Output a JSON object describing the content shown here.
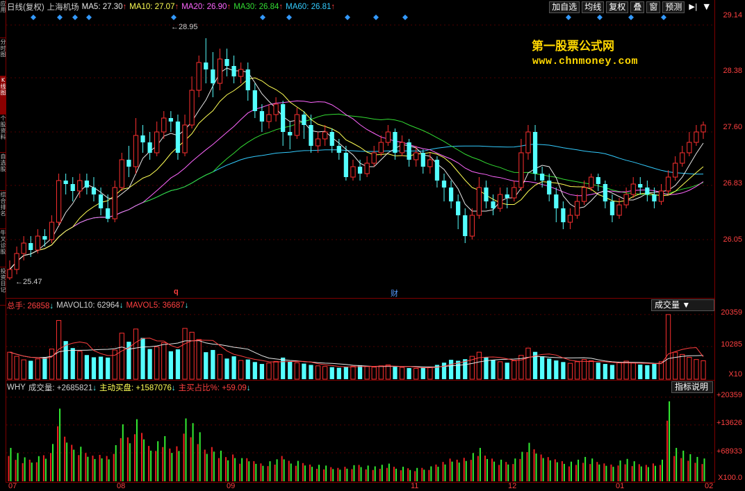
{
  "side_tabs": [
    {
      "label": "应用",
      "active": false
    },
    {
      "label": "分时图",
      "active": false
    },
    {
      "label": "K线图",
      "active": true
    },
    {
      "label": "个股资料",
      "active": false
    },
    {
      "label": "自选股",
      "active": false
    },
    {
      "label": "综合排名",
      "active": false
    },
    {
      "label": "牛叉诊股",
      "active": false
    },
    {
      "label": "投资日记",
      "active": false
    }
  ],
  "price_header": {
    "period": "日线(复权)",
    "stock_name": "上海机场",
    "ma5": "MA5: 27.30",
    "ma10": "MA10: 27.07",
    "ma20": "MA20: 26.90",
    "ma30": "MA30: 26.84",
    "ma60": "MA60: 26.81",
    "arrow_up": "↑"
  },
  "toolbar": {
    "add_watch": "加自选",
    "ma_line": "均线",
    "restore": "复权",
    "overlay": "叠",
    "window": "窗",
    "forecast": "预测",
    "nav_icon": "▶|",
    "menu_icon": "▼"
  },
  "watermark": {
    "title": "第一股票公式网",
    "url": "www.chnmoney.com"
  },
  "price_axis": [
    "29.14",
    "28.38",
    "27.60",
    "26.83",
    "26.05"
  ],
  "price_marks": {
    "high": "28.95",
    "low": "25.47",
    "q_marker": "q",
    "cai_marker": "财"
  },
  "volume_header": {
    "total": "总手: 26858",
    "mavol10": "MAVOL10: 62964",
    "mavol5": "MAVOL5: 36687",
    "arrow_down": "↓"
  },
  "volume_dropdown": "成交量 ▼",
  "volume_axis": [
    "20359",
    "10285",
    "X10"
  ],
  "why_header": {
    "name": "WHY",
    "volume": "成交量: +2685821",
    "active_buy": "主动买盘: +1587076",
    "ratio": "主买占比%: +59.09",
    "arrow_down": "↓"
  },
  "why_button": "指标说明",
  "why_axis": [
    "+20359",
    "+13626",
    "+68933",
    "X100.0"
  ],
  "time_axis": [
    "07",
    "08",
    "09",
    "11",
    "12",
    "01",
    "02"
  ],
  "colors": {
    "up": "#ff3030",
    "down": "#54ffff",
    "ma5": "#e8e8e8",
    "ma10": "#ffff55",
    "ma20": "#ff66ff",
    "ma30": "#33dd33",
    "ma60": "#33ccff",
    "frame": "#800000",
    "buy_bar": "#33ee33",
    "sell_bar": "#ee2020"
  },
  "chart_data": {
    "type": "candlestick",
    "price_range": [
      25.3,
      29.3
    ],
    "candles": [
      [
        25.5,
        25.62,
        25.47,
        25.75
      ],
      [
        25.62,
        25.85,
        25.55,
        25.95
      ],
      [
        25.85,
        26.0,
        25.75,
        26.1
      ],
      [
        26.0,
        25.9,
        25.8,
        26.1
      ],
      [
        25.9,
        26.1,
        25.85,
        26.2
      ],
      [
        26.1,
        26.05,
        25.95,
        26.2
      ],
      [
        26.05,
        26.3,
        26.0,
        26.4
      ],
      [
        26.3,
        26.9,
        26.25,
        27.0
      ],
      [
        26.9,
        26.85,
        26.7,
        27.0
      ],
      [
        26.85,
        26.75,
        26.6,
        26.95
      ],
      [
        26.75,
        26.9,
        26.65,
        27.0
      ],
      [
        26.9,
        26.8,
        26.7,
        27.0
      ],
      [
        26.8,
        26.7,
        26.6,
        26.95
      ],
      [
        26.7,
        26.5,
        26.4,
        26.8
      ],
      [
        26.5,
        26.35,
        26.3,
        26.7
      ],
      [
        26.35,
        26.8,
        26.3,
        26.9
      ],
      [
        26.8,
        27.2,
        26.75,
        27.3
      ],
      [
        27.2,
        27.1,
        26.95,
        27.4
      ],
      [
        27.1,
        27.55,
        27.0,
        27.8
      ],
      [
        27.55,
        27.45,
        27.3,
        27.7
      ],
      [
        27.45,
        27.3,
        27.2,
        27.6
      ],
      [
        27.3,
        27.6,
        27.25,
        27.75
      ],
      [
        27.6,
        27.8,
        27.5,
        27.9
      ],
      [
        27.8,
        27.75,
        27.6,
        27.9
      ],
      [
        27.75,
        27.3,
        27.2,
        27.85
      ],
      [
        27.3,
        27.7,
        27.25,
        27.85
      ],
      [
        27.7,
        28.2,
        27.65,
        28.4
      ],
      [
        28.2,
        28.6,
        28.1,
        28.7
      ],
      [
        28.6,
        28.5,
        28.3,
        28.95
      ],
      [
        28.5,
        28.3,
        28.1,
        28.75
      ],
      [
        28.3,
        28.65,
        28.2,
        28.8
      ],
      [
        28.65,
        28.55,
        28.4,
        28.8
      ],
      [
        28.55,
        28.4,
        28.3,
        28.7
      ],
      [
        28.4,
        28.5,
        28.3,
        28.6
      ],
      [
        28.5,
        28.2,
        28.05,
        28.6
      ],
      [
        28.2,
        27.9,
        27.8,
        28.3
      ],
      [
        27.9,
        27.75,
        27.6,
        28.0
      ],
      [
        27.75,
        27.85,
        27.65,
        28.0
      ],
      [
        27.85,
        28.0,
        27.75,
        28.1
      ],
      [
        28.0,
        27.6,
        27.4,
        28.05
      ],
      [
        27.6,
        27.55,
        27.35,
        27.75
      ],
      [
        27.55,
        27.85,
        27.5,
        27.95
      ],
      [
        27.85,
        27.7,
        27.5,
        27.9
      ],
      [
        27.7,
        27.4,
        27.3,
        27.85
      ],
      [
        27.4,
        27.5,
        27.3,
        27.6
      ],
      [
        27.5,
        27.6,
        27.4,
        27.7
      ],
      [
        27.6,
        27.4,
        27.3,
        27.65
      ],
      [
        27.4,
        27.3,
        27.2,
        27.5
      ],
      [
        27.3,
        26.95,
        26.9,
        27.4
      ],
      [
        26.95,
        27.1,
        26.9,
        27.2
      ],
      [
        27.1,
        27.0,
        26.9,
        27.2
      ],
      [
        27.0,
        27.15,
        26.95,
        27.25
      ],
      [
        27.15,
        27.3,
        27.1,
        27.4
      ],
      [
        27.3,
        27.45,
        27.25,
        27.55
      ],
      [
        27.45,
        27.6,
        27.4,
        27.7
      ],
      [
        27.6,
        27.3,
        27.2,
        27.65
      ],
      [
        27.3,
        27.45,
        27.25,
        27.55
      ],
      [
        27.45,
        27.2,
        27.1,
        27.5
      ],
      [
        27.2,
        27.3,
        27.1,
        27.4
      ],
      [
        27.3,
        27.1,
        27.0,
        27.35
      ],
      [
        27.1,
        27.2,
        27.0,
        27.3
      ],
      [
        27.2,
        26.9,
        26.8,
        27.25
      ],
      [
        26.9,
        26.8,
        26.6,
        27.0
      ],
      [
        26.8,
        26.6,
        26.5,
        26.9
      ],
      [
        26.6,
        26.4,
        26.2,
        26.7
      ],
      [
        26.4,
        26.1,
        26.0,
        26.5
      ],
      [
        26.1,
        26.4,
        26.05,
        26.5
      ],
      [
        26.4,
        26.8,
        26.35,
        26.95
      ],
      [
        26.8,
        26.6,
        26.5,
        26.9
      ],
      [
        26.6,
        26.5,
        26.4,
        26.7
      ],
      [
        26.5,
        26.7,
        26.45,
        26.8
      ],
      [
        26.7,
        26.65,
        26.5,
        26.8
      ],
      [
        26.65,
        26.8,
        26.6,
        26.9
      ],
      [
        26.8,
        27.3,
        26.75,
        27.5
      ],
      [
        27.3,
        27.6,
        27.2,
        27.7
      ],
      [
        27.6,
        27.0,
        26.9,
        27.7
      ],
      [
        27.0,
        26.9,
        26.8,
        27.1
      ],
      [
        26.9,
        26.7,
        26.6,
        27.0
      ],
      [
        26.7,
        26.5,
        26.3,
        26.8
      ],
      [
        26.5,
        26.3,
        26.2,
        26.6
      ],
      [
        26.3,
        26.4,
        26.2,
        26.5
      ],
      [
        26.4,
        26.6,
        26.35,
        26.7
      ],
      [
        26.6,
        26.8,
        26.55,
        26.9
      ],
      [
        26.8,
        26.95,
        26.75,
        27.0
      ],
      [
        26.95,
        26.85,
        26.75,
        27.0
      ],
      [
        26.85,
        26.6,
        26.5,
        26.9
      ],
      [
        26.6,
        26.4,
        26.3,
        26.7
      ],
      [
        26.4,
        26.55,
        26.35,
        26.65
      ],
      [
        26.55,
        26.7,
        26.5,
        26.8
      ],
      [
        26.7,
        26.85,
        26.65,
        26.95
      ],
      [
        26.85,
        26.8,
        26.7,
        26.95
      ],
      [
        26.8,
        26.7,
        26.6,
        26.9
      ],
      [
        26.7,
        26.6,
        26.5,
        26.8
      ],
      [
        26.6,
        26.75,
        26.55,
        26.85
      ],
      [
        26.75,
        26.95,
        26.7,
        27.05
      ],
      [
        26.95,
        27.15,
        26.9,
        27.25
      ],
      [
        27.15,
        27.3,
        27.1,
        27.4
      ],
      [
        27.3,
        27.45,
        27.25,
        27.6
      ],
      [
        27.45,
        27.6,
        27.4,
        27.7
      ],
      [
        27.6,
        27.7,
        27.5,
        27.75
      ]
    ],
    "volume_range": [
      0,
      21000
    ],
    "volumes": [
      8500,
      7200,
      6100,
      5800,
      6400,
      7000,
      9500,
      18500,
      12000,
      9800,
      8800,
      7600,
      6900,
      7100,
      6800,
      9200,
      14500,
      11800,
      15800,
      13000,
      9500,
      10200,
      11500,
      8800,
      9400,
      16000,
      14800,
      12500,
      8500,
      9200,
      7800,
      6500,
      7200,
      5900,
      6200,
      5400,
      4800,
      5100,
      5600,
      6800,
      5500,
      5200,
      4900,
      4500,
      4200,
      4000,
      3800,
      3600,
      3900,
      4100,
      4400,
      4000,
      3800,
      4200,
      4500,
      3900,
      3700,
      3500,
      3400,
      3600,
      3800,
      4500,
      5200,
      6100,
      5800,
      6300,
      7200,
      8500,
      6900,
      6100,
      5500,
      5200,
      5800,
      7500,
      9800,
      8600,
      7200,
      6500,
      5900,
      5400,
      5000,
      5500,
      6200,
      5800,
      5200,
      4800,
      4500,
      5300,
      5700,
      5100,
      4600,
      4400,
      4800,
      5500,
      20359,
      8500,
      7800,
      6900,
      6200,
      5800
    ],
    "ma_volume_range": [
      0,
      21000
    ]
  }
}
